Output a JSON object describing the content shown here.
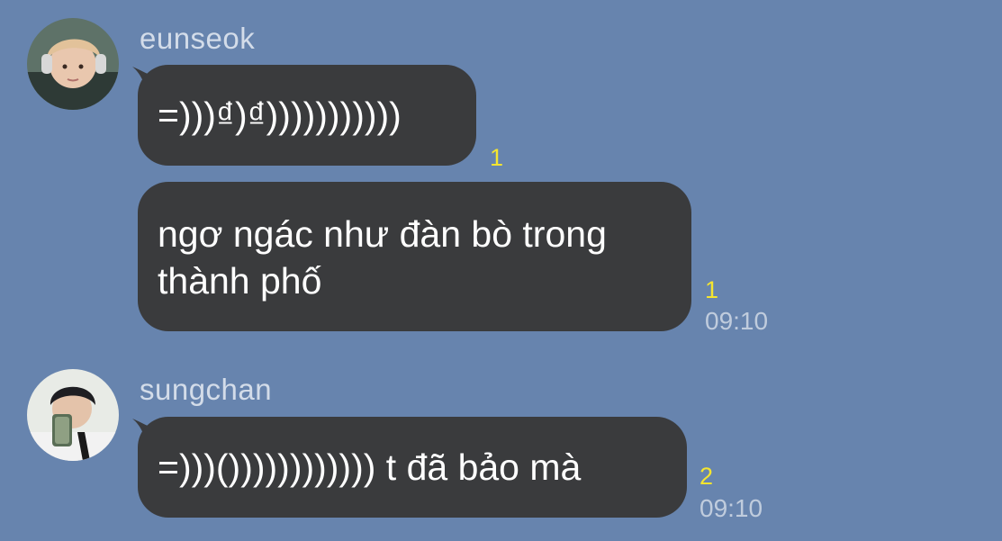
{
  "messages": [
    {
      "sender": "eunseok",
      "avatar_icon": "avatar-photo-icon",
      "bubbles": [
        {
          "text": "=)))₫)₫)))))))))))",
          "read_count": "1"
        },
        {
          "text": "ngơ ngác như đàn bò trong\nthành phố",
          "read_count": "1",
          "time": "09:10"
        }
      ]
    },
    {
      "sender": "sungchan",
      "avatar_icon": "avatar-photo-icon",
      "bubbles": [
        {
          "text": "=)))()))))))))))) t đã bảo mà",
          "read_count": "2",
          "time": "09:10"
        }
      ]
    }
  ],
  "colors": {
    "background": "#6784AE",
    "bubble": "#3A3B3D",
    "bubble_text": "#FFFFFF",
    "sender_name": "#D3DCE9",
    "read_count": "#F5E52F",
    "timestamp": "#C0CCDD"
  }
}
